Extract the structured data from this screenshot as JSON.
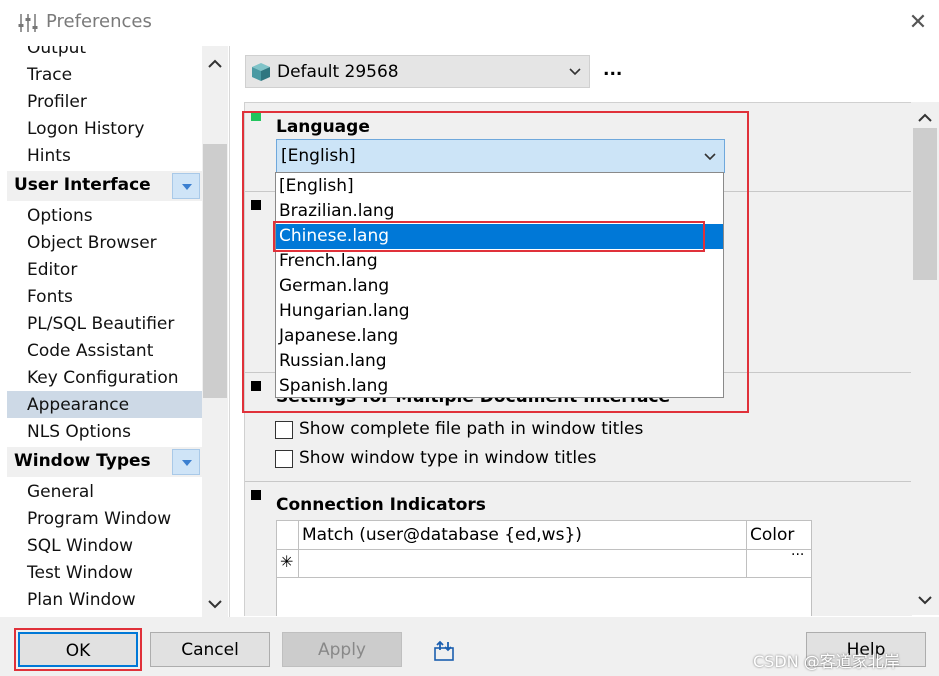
{
  "window": {
    "title": "Preferences",
    "close_label": "✕"
  },
  "sidebar": {
    "items_top": [
      "Output",
      "Trace",
      "Profiler",
      "Logon History",
      "Hints"
    ],
    "header_ui": "User Interface",
    "items_ui": [
      "Options",
      "Object Browser",
      "Editor",
      "Fonts",
      "PL/SQL Beautifier",
      "Code Assistant",
      "Key Configuration",
      "Appearance",
      "NLS Options"
    ],
    "selected": "Appearance",
    "header_window_types": "Window Types",
    "items_wt": [
      "General",
      "Program Window",
      "SQL Window",
      "Test Window",
      "Plan Window"
    ]
  },
  "toolbar": {
    "profile_name": "Default 29568",
    "more_label": "..."
  },
  "language": {
    "title": "Language",
    "current_value": "[English]",
    "options": [
      "[English]",
      "Brazilian.lang",
      "Chinese.lang",
      "French.lang",
      "German.lang",
      "Hungarian.lang",
      "Japanese.lang",
      "Russian.lang",
      "Spanish.lang"
    ],
    "highlighted": "Chinese.lang"
  },
  "mdi": {
    "title": "Settings for Multiple Document Interface",
    "opt1": "Show complete file path in window titles",
    "opt2": "Show window type in window titles"
  },
  "connection": {
    "title": "Connection Indicators",
    "col_match": "Match (user@database {ed,ws})",
    "col_color": "Color",
    "new_row_glyph": "✳",
    "color_btn": "···"
  },
  "buttons": {
    "ok": "OK",
    "cancel": "Cancel",
    "apply": "Apply",
    "help": "Help"
  },
  "watermark": "CSDN @客道家北岸",
  "colors": {
    "selection": "#0078d7",
    "highlight_box": "#e0313a",
    "sidebar_selected": "#cdd9e6"
  }
}
